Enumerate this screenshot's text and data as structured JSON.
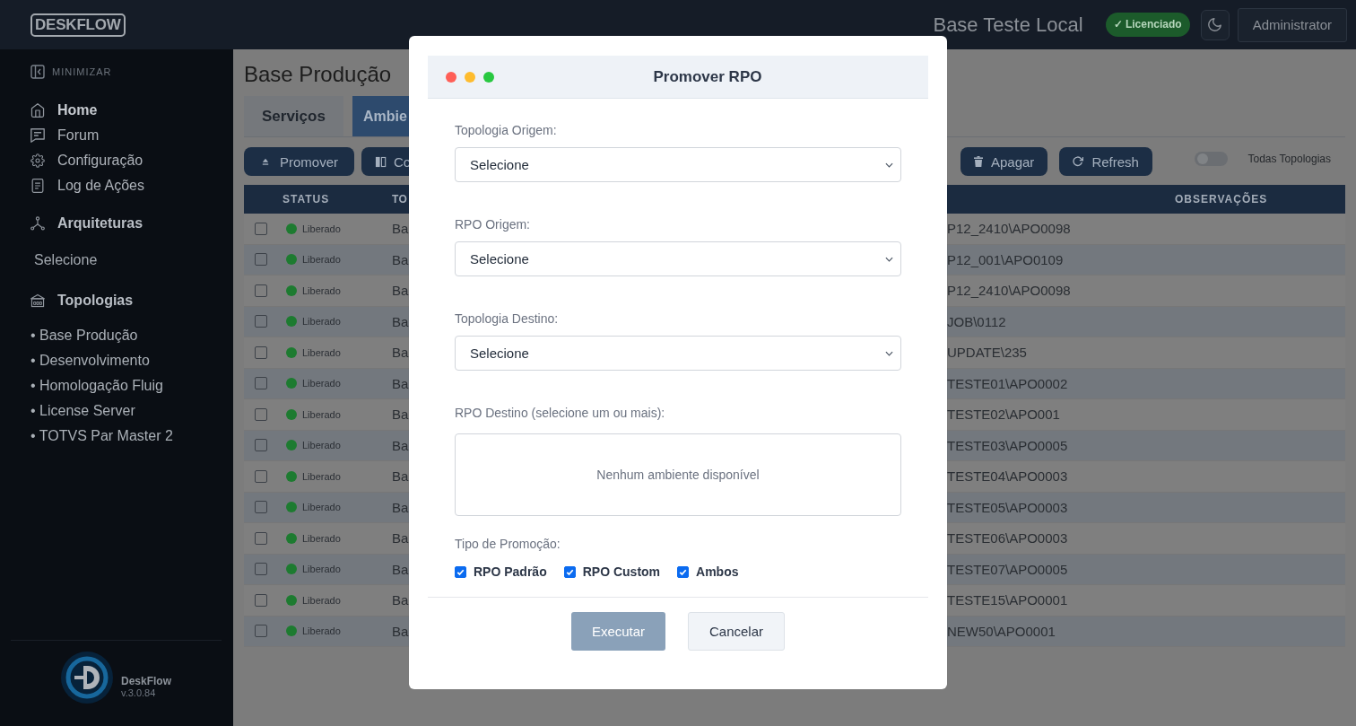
{
  "header": {
    "logo": "DESKFLOW",
    "environment": "Base Teste Local",
    "license_badge": "✓ Licenciado",
    "user_button": "Administrator"
  },
  "sidebar": {
    "minimize_label": "MINIMIZAR",
    "nav_items": [
      {
        "label": "Home",
        "selected": true
      },
      {
        "label": "Forum",
        "selected": false
      },
      {
        "label": "Configuração",
        "selected": false
      },
      {
        "label": "Log de Ações",
        "selected": false
      }
    ],
    "architectures": {
      "title": "Arquiteturas",
      "value": "Selecione"
    },
    "topologies": {
      "title": "Topologias",
      "items": [
        "• Base Produção",
        "• Desenvolvimento",
        "• Homologação Fluig",
        "• License Server",
        "• TOTVS Par Master 2"
      ]
    },
    "footer": {
      "name": "DeskFlow",
      "version": "v.3.0.84"
    }
  },
  "page": {
    "title": "Base Produção",
    "tabs": [
      {
        "label": "Serviços",
        "selected": false
      },
      {
        "label": "Ambie",
        "selected": true
      }
    ],
    "toolbar": {
      "buttons": [
        "Promover",
        "Co",
        "Apagar",
        "Refresh"
      ],
      "toggle": {
        "label": "Todas Topologias",
        "on": false
      }
    },
    "table": {
      "columns": [
        "STATUS",
        "TO",
        "OBSERVAÇÕES"
      ],
      "rows": [
        {
          "checked": false,
          "status": "Liberado",
          "column_3": "Ba",
          "column_4": "P12_2410\\APO0098"
        },
        {
          "checked": false,
          "status": "Liberado",
          "column_3": "Ba",
          "column_4": "P12_001\\APO0109"
        },
        {
          "checked": false,
          "status": "Liberado",
          "column_3": "Ba",
          "column_4": "P12_2410\\APO0098"
        },
        {
          "checked": false,
          "status": "Liberado",
          "column_3": "Ba",
          "column_4": "JOB\\0112"
        },
        {
          "checked": false,
          "status": "Liberado",
          "column_3": "Ba",
          "column_4": "UPDATE\\235"
        },
        {
          "checked": false,
          "status": "Liberado",
          "column_3": "Ba",
          "column_4": "TESTE01\\APO0002"
        },
        {
          "checked": false,
          "status": "Liberado",
          "column_3": "Ba",
          "column_4": "TESTE02\\APO001"
        },
        {
          "checked": false,
          "status": "Liberado",
          "column_3": "Ba",
          "column_4": "TESTE03\\APO0005"
        },
        {
          "checked": false,
          "status": "Liberado",
          "column_3": "Ba",
          "column_4": "TESTE04\\APO0003"
        },
        {
          "checked": false,
          "status": "Liberado",
          "column_3": "Ba",
          "column_4": "TESTE05\\APO0003"
        },
        {
          "checked": false,
          "status": "Liberado",
          "column_3": "Ba",
          "column_4": "TESTE06\\APO0003"
        },
        {
          "checked": false,
          "status": "Liberado",
          "column_3": "Ba",
          "column_4": "TESTE07\\APO0005"
        },
        {
          "checked": false,
          "status": "Liberado",
          "column_3": "Ba",
          "column_4": "TESTE15\\APO0001"
        },
        {
          "checked": false,
          "status": "Liberado",
          "column_3": "Ba",
          "column_4": "NEW50\\APO0001"
        }
      ]
    }
  },
  "modal": {
    "title": "Promover RPO",
    "fields": [
      {
        "kind": "select",
        "label": "Topologia Origem:",
        "value": "Selecione"
      },
      {
        "kind": "select",
        "label": "RPO Origem:",
        "value": "Selecione"
      },
      {
        "kind": "select",
        "label": "Topologia Destino:",
        "value": "Selecione"
      },
      {
        "kind": "list",
        "label": "RPO Destino (selecione um ou mais):",
        "empty_text": "Nenhum ambiente disponível"
      }
    ],
    "promotion_type": {
      "label": "Tipo de Promoção:",
      "options": [
        {
          "label": "RPO Padrão",
          "checked": true
        },
        {
          "label": "RPO Custom",
          "checked": true
        },
        {
          "label": "Ambos",
          "checked": true
        }
      ]
    },
    "buttons": [
      {
        "label": "Executar",
        "kind": "primary",
        "disabled": true
      },
      {
        "label": "Cancelar",
        "kind": "secondary",
        "disabled": false
      }
    ]
  }
}
